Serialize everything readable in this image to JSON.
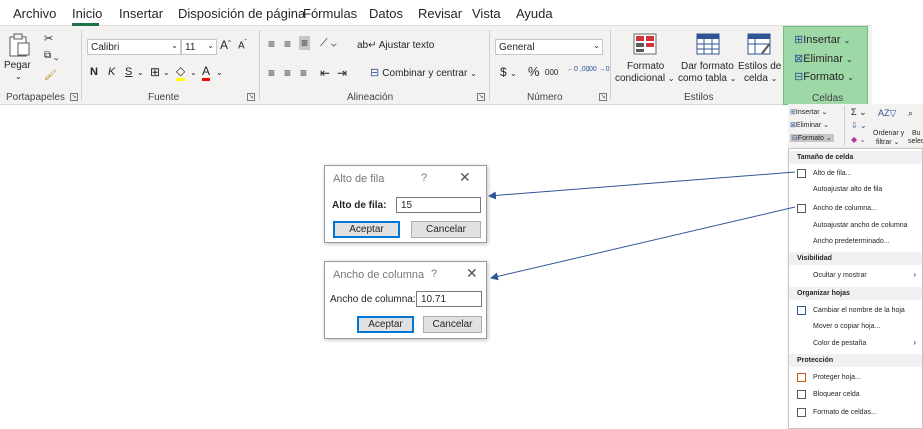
{
  "tabs": [
    "Archivo",
    "Inicio",
    "Insertar",
    "Disposición de página",
    "Fórmulas",
    "Datos",
    "Revisar",
    "Vista",
    "Ayuda"
  ],
  "ribbon": {
    "portapapeles": {
      "paste_label": "Pegar",
      "group_label": "Portapapeles"
    },
    "fuente": {
      "font_name": "Calibri",
      "font_size": "11",
      "bold": "N",
      "italic": "K",
      "underline": "S",
      "group_label": "Fuente"
    },
    "alineacion": {
      "wrap_text": "Ajustar texto",
      "merge_center": "Combinar y centrar",
      "group_label": "Alineación"
    },
    "numero": {
      "format": "General",
      "currency": "$",
      "percent": "%",
      "thousands": "000",
      "dec_inc": "←0 ,00",
      "dec_dec": ",00 →0",
      "group_label": "Número"
    },
    "estilos": {
      "cond_format_1": "Formato",
      "cond_format_2": "condicional",
      "table_format_1": "Dar formato",
      "table_format_2": "como tabla",
      "cell_styles_1": "Estilos de",
      "cell_styles_2": "celda",
      "group_label": "Estilos"
    },
    "celdas": {
      "insert": "Insertar",
      "delete": "Eliminar",
      "format": "Formato",
      "group_label": "Celdas"
    }
  },
  "mini_ribbon": {
    "insert": "Insertar",
    "delete": "Eliminar",
    "format": "Formato",
    "sort_filter_1": "Ordenar y",
    "sort_filter_2": "filtrar",
    "find_1": "Bu",
    "find_2": "selec"
  },
  "menu": {
    "h_size": "Tamaño de celda",
    "row_height": "Alto de fila...",
    "autofit_row": "Autoajustar alto de fila",
    "col_width": "Ancho de columna...",
    "autofit_col": "Autoajustar ancho de columna",
    "default_width": "Ancho predeterminado...",
    "h_visibility": "Visibilidad",
    "hide_show": "Ocultar y mostrar",
    "h_organize": "Organizar hojas",
    "rename": "Cambiar el nombre de la hoja",
    "move_copy": "Mover o copiar hoja...",
    "tab_color": "Color de pestaña",
    "h_protection": "Protección",
    "protect": "Proteger hoja...",
    "lock": "Bloquear celda",
    "format_cells": "Formato de celdas..."
  },
  "dialog_row": {
    "title": "Alto de fila",
    "help": "?",
    "close": "✕",
    "label": "Alto de fila:",
    "value": "15",
    "ok": "Aceptar",
    "cancel": "Cancelar"
  },
  "dialog_col": {
    "title": "Ancho de columna",
    "help": "?",
    "close": "✕",
    "label": "Ancho de columna:",
    "value": "10.71",
    "ok": "Aceptar",
    "cancel": "Cancelar"
  },
  "colors": {
    "accent": "#217346",
    "selected_group": "#9fd8a7",
    "arrow": "#2f5597"
  }
}
